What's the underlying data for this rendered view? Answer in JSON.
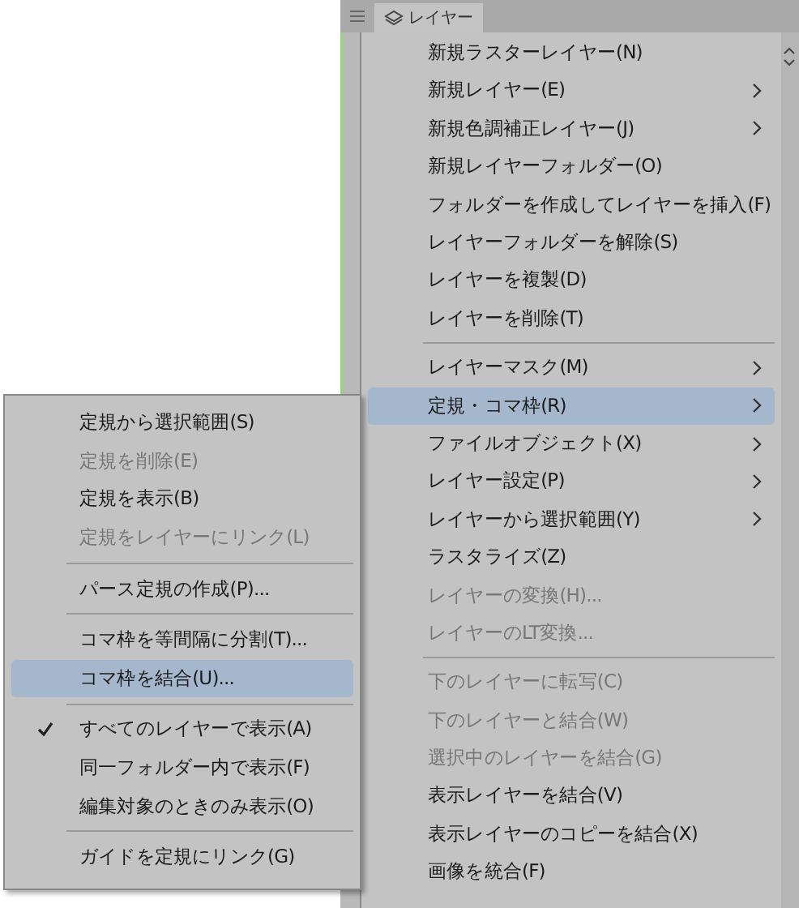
{
  "panel": {
    "tab_label": "レイヤー"
  },
  "menu": [
    {
      "kind": "item",
      "label": "新規ラスターレイヤー(N)",
      "disabled": false,
      "selected": false,
      "has_submenu": false
    },
    {
      "kind": "item",
      "label": "新規レイヤー(E)",
      "disabled": false,
      "selected": false,
      "has_submenu": true
    },
    {
      "kind": "item",
      "label": "新規色調補正レイヤー(J)",
      "disabled": false,
      "selected": false,
      "has_submenu": true
    },
    {
      "kind": "item",
      "label": "新規レイヤーフォルダー(O)",
      "disabled": false,
      "selected": false,
      "has_submenu": false
    },
    {
      "kind": "item",
      "label": "フォルダーを作成してレイヤーを挿入(F)",
      "disabled": false,
      "selected": false,
      "has_submenu": false
    },
    {
      "kind": "item",
      "label": "レイヤーフォルダーを解除(S)",
      "disabled": false,
      "selected": false,
      "has_submenu": false
    },
    {
      "kind": "item",
      "label": "レイヤーを複製(D)",
      "disabled": false,
      "selected": false,
      "has_submenu": false
    },
    {
      "kind": "item",
      "label": "レイヤーを削除(T)",
      "disabled": false,
      "selected": false,
      "has_submenu": false
    },
    {
      "kind": "separator"
    },
    {
      "kind": "item",
      "label": "レイヤーマスク(M)",
      "disabled": false,
      "selected": false,
      "has_submenu": true
    },
    {
      "kind": "item",
      "label": "定規・コマ枠(R)",
      "disabled": false,
      "selected": true,
      "has_submenu": true
    },
    {
      "kind": "item",
      "label": "ファイルオブジェクト(X)",
      "disabled": false,
      "selected": false,
      "has_submenu": true
    },
    {
      "kind": "item",
      "label": "レイヤー設定(P)",
      "disabled": false,
      "selected": false,
      "has_submenu": true
    },
    {
      "kind": "item",
      "label": "レイヤーから選択範囲(Y)",
      "disabled": false,
      "selected": false,
      "has_submenu": true
    },
    {
      "kind": "item",
      "label": "ラスタライズ(Z)",
      "disabled": false,
      "selected": false,
      "has_submenu": false
    },
    {
      "kind": "item",
      "label": "レイヤーの変換(H)...",
      "disabled": true,
      "selected": false,
      "has_submenu": false
    },
    {
      "kind": "item",
      "label": "レイヤーのLT変換...",
      "disabled": true,
      "selected": false,
      "has_submenu": false
    },
    {
      "kind": "separator"
    },
    {
      "kind": "item",
      "label": "下のレイヤーに転写(C)",
      "disabled": true,
      "selected": false,
      "has_submenu": false
    },
    {
      "kind": "item",
      "label": "下のレイヤーと結合(W)",
      "disabled": true,
      "selected": false,
      "has_submenu": false
    },
    {
      "kind": "item",
      "label": "選択中のレイヤーを結合(G)",
      "disabled": true,
      "selected": false,
      "has_submenu": false
    },
    {
      "kind": "item",
      "label": "表示レイヤーを結合(V)",
      "disabled": false,
      "selected": false,
      "has_submenu": false
    },
    {
      "kind": "item",
      "label": "表示レイヤーのコピーを結合(X)",
      "disabled": false,
      "selected": false,
      "has_submenu": false
    },
    {
      "kind": "item",
      "label": "画像を統合(F)",
      "disabled": false,
      "selected": false,
      "has_submenu": false
    }
  ],
  "submenu": [
    {
      "kind": "item",
      "label": "定規から選択範囲(S)",
      "disabled": false,
      "selected": false,
      "checked": false
    },
    {
      "kind": "item",
      "label": "定規を削除(E)",
      "disabled": true,
      "selected": false,
      "checked": false
    },
    {
      "kind": "item",
      "label": "定規を表示(B)",
      "disabled": false,
      "selected": false,
      "checked": false
    },
    {
      "kind": "item",
      "label": "定規をレイヤーにリンク(L)",
      "disabled": true,
      "selected": false,
      "checked": false
    },
    {
      "kind": "separator"
    },
    {
      "kind": "item",
      "label": "パース定規の作成(P)...",
      "disabled": false,
      "selected": false,
      "checked": false
    },
    {
      "kind": "separator"
    },
    {
      "kind": "item",
      "label": "コマ枠を等間隔に分割(T)...",
      "disabled": false,
      "selected": false,
      "checked": false
    },
    {
      "kind": "item",
      "label": "コマ枠を結合(U)...",
      "disabled": false,
      "selected": true,
      "checked": false
    },
    {
      "kind": "separator"
    },
    {
      "kind": "item",
      "label": "すべてのレイヤーで表示(A)",
      "disabled": false,
      "selected": false,
      "checked": true
    },
    {
      "kind": "item",
      "label": "同一フォルダー内で表示(F)",
      "disabled": false,
      "selected": false,
      "checked": false
    },
    {
      "kind": "item",
      "label": "編集対象のときのみ表示(O)",
      "disabled": false,
      "selected": false,
      "checked": false
    },
    {
      "kind": "separator"
    },
    {
      "kind": "item",
      "label": "ガイドを定規にリンク(G)",
      "disabled": false,
      "selected": false,
      "checked": false
    }
  ]
}
